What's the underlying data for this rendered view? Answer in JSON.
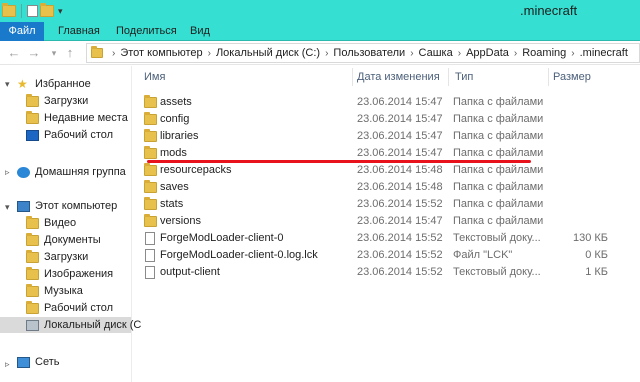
{
  "window": {
    "title": ".minecraft"
  },
  "ribbon": {
    "file_tab": "Файл",
    "tabs": [
      "Главная",
      "Поделиться",
      "Вид"
    ]
  },
  "address": {
    "crumbs": [
      "Этот компьютер",
      "Локальный диск (C:)",
      "Пользователи",
      "Сашка",
      "AppData",
      "Roaming",
      ".minecraft"
    ]
  },
  "nav": {
    "favorites": "Избранное",
    "downloads": "Загрузки",
    "recent": "Недавние места",
    "desktop": "Рабочий стол",
    "homegroup": "Домашняя группа",
    "this_pc": "Этот компьютер",
    "video": "Видео",
    "documents": "Документы",
    "pc_downloads": "Загрузки",
    "pictures": "Изображения",
    "music": "Музыка",
    "pc_desktop": "Рабочий стол",
    "local_disk": "Локальный диск (C",
    "network": "Сеть"
  },
  "columns": {
    "name": "Имя",
    "date": "Дата изменения",
    "type": "Тип",
    "size": "Размер"
  },
  "files": [
    {
      "name": "assets",
      "date": "23.06.2014 15:47",
      "type": "Папка с файлами",
      "size": "",
      "kind": "folder"
    },
    {
      "name": "config",
      "date": "23.06.2014 15:47",
      "type": "Папка с файлами",
      "size": "",
      "kind": "folder"
    },
    {
      "name": "libraries",
      "date": "23.06.2014 15:47",
      "type": "Папка с файлами",
      "size": "",
      "kind": "folder"
    },
    {
      "name": "mods",
      "date": "23.06.2014 15:47",
      "type": "Папка с файлами",
      "size": "",
      "kind": "folder"
    },
    {
      "name": "resourcepacks",
      "date": "23.06.2014 15:48",
      "type": "Папка с файлами",
      "size": "",
      "kind": "folder"
    },
    {
      "name": "saves",
      "date": "23.06.2014 15:48",
      "type": "Папка с файлами",
      "size": "",
      "kind": "folder"
    },
    {
      "name": "stats",
      "date": "23.06.2014 15:52",
      "type": "Папка с файлами",
      "size": "",
      "kind": "folder"
    },
    {
      "name": "versions",
      "date": "23.06.2014 15:47",
      "type": "Папка с файлами",
      "size": "",
      "kind": "folder"
    },
    {
      "name": "ForgeModLoader-client-0",
      "date": "23.06.2014 15:52",
      "type": "Текстовый доку...",
      "size": "130 КБ",
      "kind": "file"
    },
    {
      "name": "ForgeModLoader-client-0.log.lck",
      "date": "23.06.2014 15:52",
      "type": "Файл \"LCK\"",
      "size": "0 КБ",
      "kind": "file"
    },
    {
      "name": "output-client",
      "date": "23.06.2014 15:52",
      "type": "Текстовый доку...",
      "size": "1 КБ",
      "kind": "file"
    }
  ],
  "colors": {
    "titlebar": "#35e0d2",
    "file_tab": "#1979ca",
    "highlight_line": "#e8121c"
  }
}
